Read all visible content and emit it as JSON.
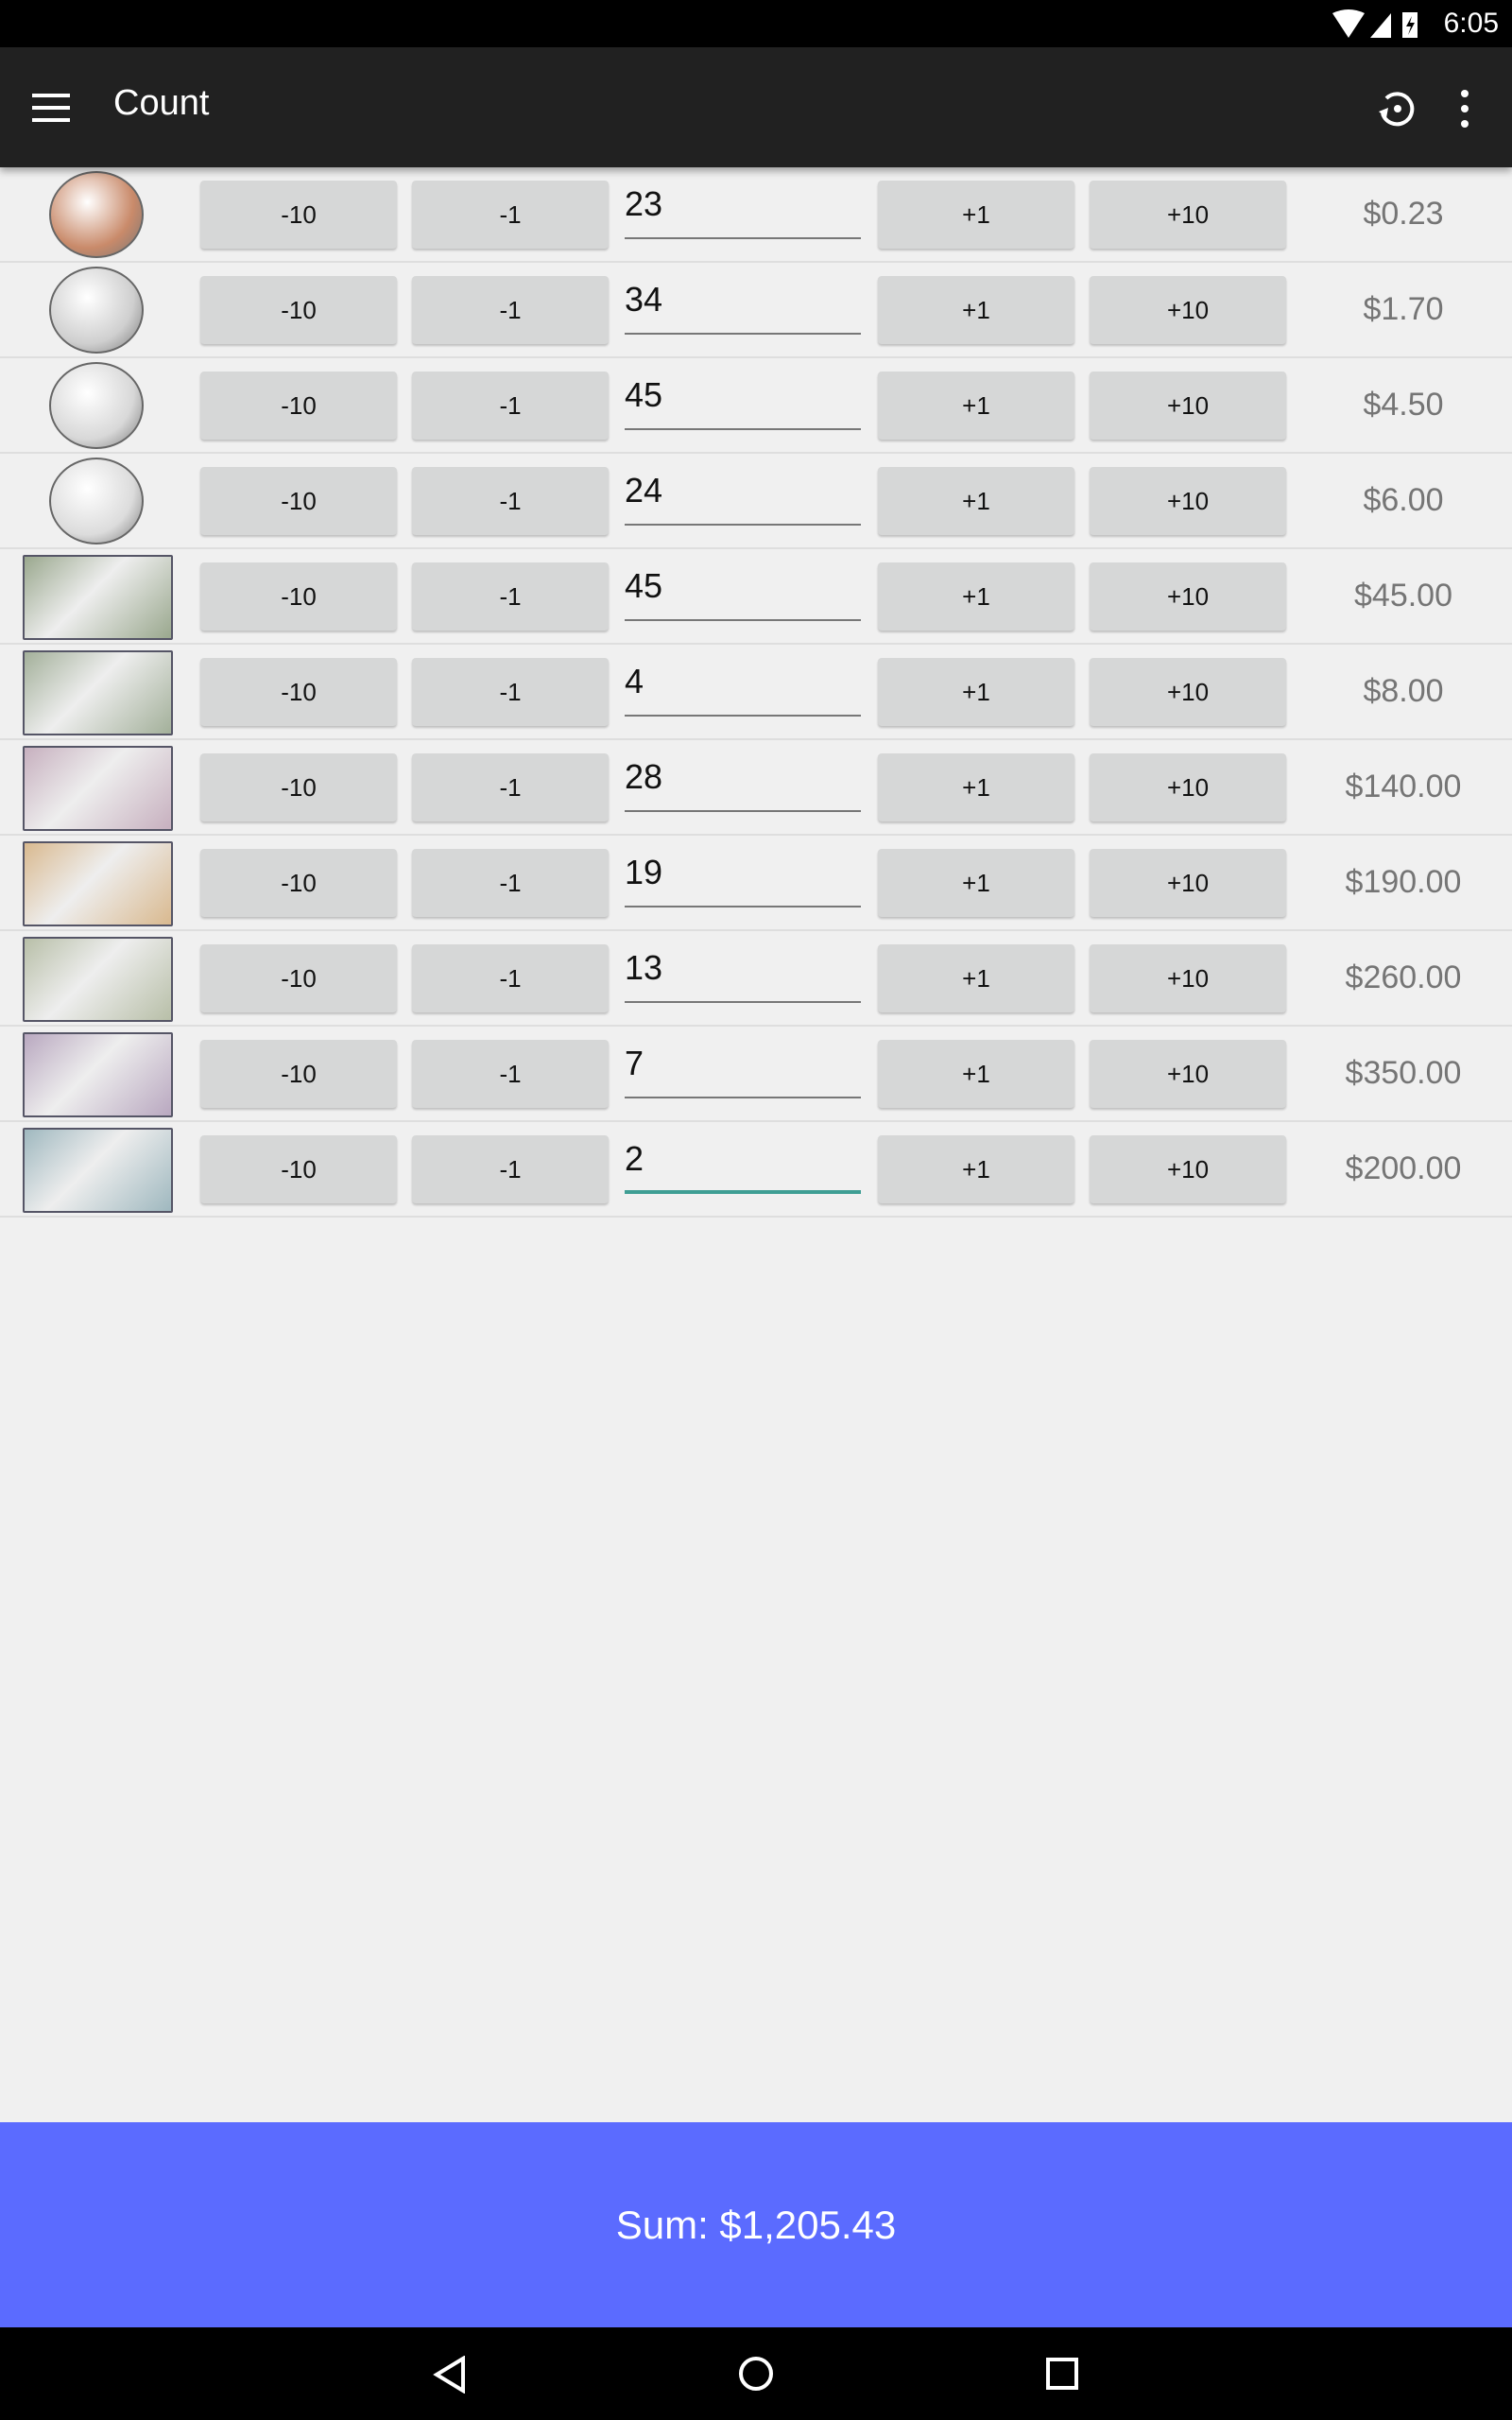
{
  "status_bar": {
    "time": "6:05",
    "icons": [
      "wifi-icon",
      "signal-icon",
      "battery-charging-icon"
    ]
  },
  "app_bar": {
    "title": "Count",
    "icons": [
      "menu-icon",
      "history-icon",
      "more-vert-icon"
    ]
  },
  "buttons": {
    "minus10": "-10",
    "minus1": "-1",
    "plus1": "+1",
    "plus10": "+10"
  },
  "rows": [
    {
      "denomination": "penny",
      "count": "23",
      "value": "$0.23",
      "color": "#c98a6a"
    },
    {
      "denomination": "nickel",
      "count": "34",
      "value": "$1.70",
      "color": "#cfcfcf"
    },
    {
      "denomination": "dime",
      "count": "45",
      "value": "$4.50",
      "color": "#d8d8d8"
    },
    {
      "denomination": "quarter",
      "count": "24",
      "value": "$6.00",
      "color": "#dcdcdc"
    },
    {
      "denomination": "one-dollar-bill",
      "count": "45",
      "value": "$45.00",
      "color": "#9aa88e"
    },
    {
      "denomination": "two-dollar-bill",
      "count": "4",
      "value": "$8.00",
      "color": "#a3b09a"
    },
    {
      "denomination": "five-dollar-bill",
      "count": "28",
      "value": "$140.00",
      "color": "#c7b0bf"
    },
    {
      "denomination": "ten-dollar-bill",
      "count": "19",
      "value": "$190.00",
      "color": "#d9b98f"
    },
    {
      "denomination": "twenty-dollar-bill",
      "count": "13",
      "value": "$260.00",
      "color": "#b8bfa8"
    },
    {
      "denomination": "fifty-dollar-bill",
      "count": "7",
      "value": "$350.00",
      "color": "#b9a8c0"
    },
    {
      "denomination": "hundred-dollar-bill",
      "count": "2",
      "value": "$200.00",
      "color": "#9fb8bf",
      "focused": true
    }
  ],
  "sum": {
    "text": "Sum: $1,205.43",
    "color": "#5b6bff"
  },
  "nav_bar": {
    "icons": [
      "back-icon",
      "home-icon",
      "recents-icon"
    ]
  }
}
